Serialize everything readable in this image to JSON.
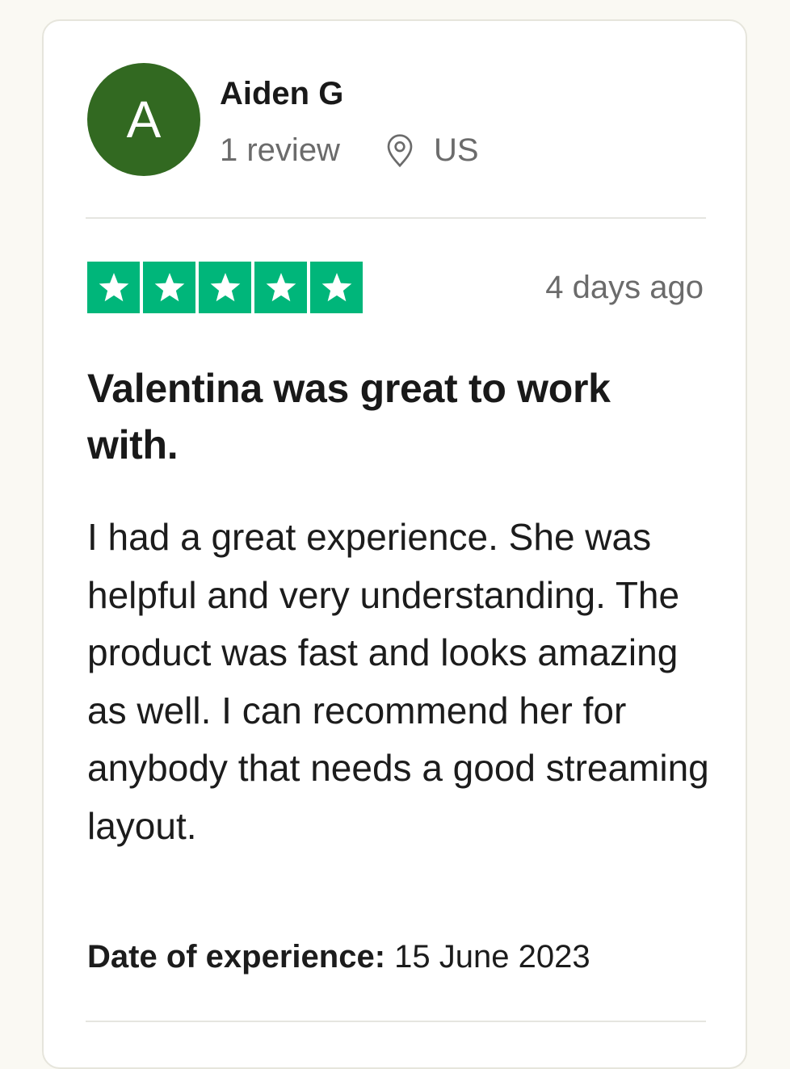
{
  "reviewer": {
    "avatar_initial": "A",
    "name": "Aiden G",
    "review_count": "1 review",
    "location": "US"
  },
  "review": {
    "rating": 5,
    "rating_max": 5,
    "posted": "4 days ago",
    "title": "Valentina was great to work with.",
    "body": "I had a great experience. She was helpful and very understanding. The product was fast and looks amazing as well. I can recommend her for anybody that needs a good streaming layout.",
    "date_of_experience_label": "Date of experience:",
    "date_of_experience_value": "15 June 2023"
  },
  "icons": {
    "location": "map-pin-icon",
    "star": "star-icon"
  },
  "colors": {
    "avatar_bg": "#326921",
    "star_bg": "#00b67a",
    "page_bg": "#faf9f3"
  }
}
